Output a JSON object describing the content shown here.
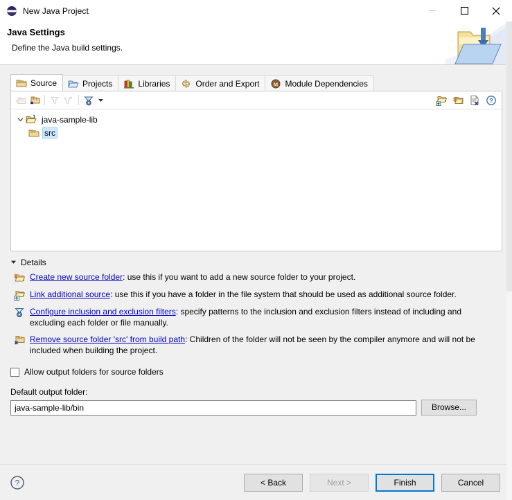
{
  "window": {
    "title": "New Java Project",
    "icon": "eclipse-icon",
    "controls": {
      "minimize": "minimize-icon",
      "maximize": "maximize-icon",
      "close": "close-icon"
    }
  },
  "header": {
    "title": "Java Settings",
    "subtitle": "Define the Java build settings.",
    "banner_icon": "folder-banner-icon"
  },
  "tabs": [
    {
      "label": "Source",
      "icon": "source-folder-icon",
      "active": true
    },
    {
      "label": "Projects",
      "icon": "projects-folder-icon",
      "active": false
    },
    {
      "label": "Libraries",
      "icon": "libraries-books-icon",
      "active": false
    },
    {
      "label": "Order and Export",
      "icon": "order-export-icon",
      "active": false
    },
    {
      "label": "Module Dependencies",
      "icon": "module-dependencies-icon",
      "active": false
    }
  ],
  "tree_toolbar": {
    "buttons": [
      {
        "name": "add-source-folder-icon",
        "enabled": false
      },
      {
        "name": "remove-source-folder-icon",
        "enabled": true
      },
      {
        "name": "filter-icon",
        "enabled": false
      },
      {
        "name": "add-filter-icon",
        "enabled": false
      },
      {
        "name": "configure-filters-icon",
        "enabled": true
      },
      {
        "name": "toolbar-dropdown-arrow-icon",
        "enabled": true
      }
    ],
    "right_buttons": [
      {
        "name": "add-folder-icon"
      },
      {
        "name": "link-source-icon"
      },
      {
        "name": "remove-entry-icon"
      },
      {
        "name": "help-icon"
      }
    ]
  },
  "tree": {
    "root": {
      "label": "java-sample-lib",
      "icon": "project-folder-icon",
      "expanded": true,
      "twisty": "chevron-down-icon"
    },
    "children": [
      {
        "label": "src",
        "icon": "source-folder-icon",
        "selected": true
      }
    ]
  },
  "details": {
    "section_label": "Details",
    "expander": "triangle-down-icon",
    "items": [
      {
        "icon": "create-source-folder-icon",
        "link": "Create new source folder",
        "text": ": use this if you want to add a new source folder to your project."
      },
      {
        "icon": "link-additional-source-icon",
        "link": "Link additional source",
        "text": ": use this if you have a folder in the file system that should be used as additional source folder."
      },
      {
        "icon": "configure-filters-icon",
        "link": "Configure inclusion and exclusion filters",
        "text": ": specify patterns to the inclusion and exclusion filters instead of including and excluding each folder or file manually."
      },
      {
        "icon": "remove-source-folder-icon",
        "link": "Remove source folder 'src' from build path",
        "text": ": Children of the folder will not be seen by the compiler anymore and will not be included when building the project."
      }
    ]
  },
  "options": {
    "allow_output_folders_label": "Allow output folders for source folders",
    "allow_output_folders_checked": false,
    "default_output_folder_label": "Default output folder:",
    "default_output_folder_value": "java-sample-lib/bin",
    "browse_label": "Browse..."
  },
  "footer": {
    "help_icon": "help-circle-icon",
    "buttons": [
      {
        "label": "< Back",
        "state": "enabled"
      },
      {
        "label": "Next >",
        "state": "disabled"
      },
      {
        "label": "Finish",
        "state": "default"
      },
      {
        "label": "Cancel",
        "state": "enabled"
      }
    ]
  },
  "colors": {
    "dialog_bg": "#f0f0f0",
    "panel_bg": "#ffffff",
    "link": "#0000c0",
    "selection": "#cde8ff",
    "default_button_border": "#0078d7"
  }
}
